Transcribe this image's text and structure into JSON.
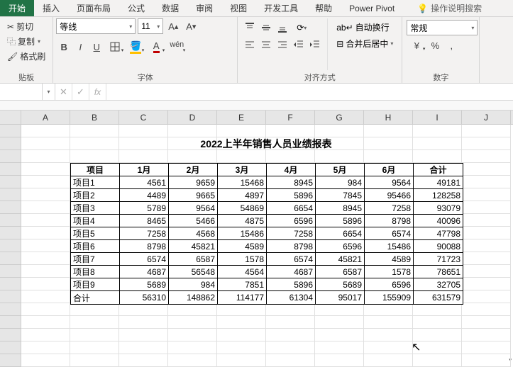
{
  "tabs": {
    "start": "开始",
    "insert": "插入",
    "pageLayout": "页面布局",
    "formula": "公式",
    "data": "数据",
    "review": "审阅",
    "view": "视图",
    "devTools": "开发工具",
    "help": "帮助",
    "powerPivot": "Power Pivot",
    "search": "操作说明搜索"
  },
  "clipboard": {
    "cut": "剪切",
    "copy": "复制",
    "formatPainter": "格式刷",
    "group": "贴板"
  },
  "font": {
    "name": "等线",
    "size": "11",
    "group": "字体"
  },
  "align": {
    "wrap": "自动换行",
    "merge": "合并后居中",
    "group": "对齐方式"
  },
  "number": {
    "format": "常规",
    "group": "数字"
  },
  "formulaBar": {
    "nameBox": "",
    "value": ""
  },
  "cols": [
    "A",
    "B",
    "C",
    "D",
    "E",
    "F",
    "G",
    "H",
    "I",
    "J"
  ],
  "title": "2022上半年销售人员业绩报表",
  "table": {
    "headers": [
      "项目",
      "1月",
      "2月",
      "3月",
      "4月",
      "5月",
      "6月",
      "合计"
    ],
    "rows": [
      [
        "项目1",
        "4561",
        "9659",
        "15468",
        "8945",
        "984",
        "9564",
        "49181"
      ],
      [
        "项目2",
        "4489",
        "9665",
        "4897",
        "5896",
        "7845",
        "95466",
        "128258"
      ],
      [
        "项目3",
        "5789",
        "9564",
        "54869",
        "6654",
        "8945",
        "7258",
        "93079"
      ],
      [
        "项目4",
        "8465",
        "5466",
        "4875",
        "6596",
        "5896",
        "8798",
        "40096"
      ],
      [
        "项目5",
        "7258",
        "4568",
        "15486",
        "7258",
        "6654",
        "6574",
        "47798"
      ],
      [
        "项目6",
        "8798",
        "45821",
        "4589",
        "8798",
        "6596",
        "15486",
        "90088"
      ],
      [
        "项目7",
        "6574",
        "6587",
        "1578",
        "6574",
        "45821",
        "4589",
        "71723"
      ],
      [
        "项目8",
        "4687",
        "56548",
        "4564",
        "4687",
        "6587",
        "1578",
        "78651"
      ],
      [
        "项目9",
        "5689",
        "984",
        "7851",
        "5896",
        "5689",
        "6596",
        "32705"
      ],
      [
        "合计",
        "56310",
        "148862",
        "114177",
        "61304",
        "95017",
        "155909",
        "631579"
      ]
    ]
  },
  "chart_data": {
    "type": "table",
    "title": "2022上半年销售人员业绩报表",
    "columns": [
      "项目",
      "1月",
      "2月",
      "3月",
      "4月",
      "5月",
      "6月",
      "合计"
    ],
    "rows": [
      {
        "项目": "项目1",
        "1月": 4561,
        "2月": 9659,
        "3月": 15468,
        "4月": 8945,
        "5月": 984,
        "6月": 9564,
        "合计": 49181
      },
      {
        "项目": "项目2",
        "1月": 4489,
        "2月": 9665,
        "3月": 4897,
        "4月": 5896,
        "5月": 7845,
        "6月": 95466,
        "合计": 128258
      },
      {
        "项目": "项目3",
        "1月": 5789,
        "2月": 9564,
        "3月": 54869,
        "4月": 6654,
        "5月": 8945,
        "6月": 7258,
        "合计": 93079
      },
      {
        "项目": "项目4",
        "1月": 8465,
        "2月": 5466,
        "3月": 4875,
        "4月": 6596,
        "5月": 5896,
        "6月": 8798,
        "合计": 40096
      },
      {
        "项目": "项目5",
        "1月": 7258,
        "2月": 4568,
        "3月": 15486,
        "4月": 7258,
        "5月": 6654,
        "6月": 6574,
        "合计": 47798
      },
      {
        "项目": "项目6",
        "1月": 8798,
        "2月": 45821,
        "3月": 4589,
        "4月": 8798,
        "5月": 6596,
        "6月": 15486,
        "合计": 90088
      },
      {
        "项目": "项目7",
        "1月": 6574,
        "2月": 6587,
        "3月": 1578,
        "4月": 6574,
        "5月": 45821,
        "6月": 4589,
        "合计": 71723
      },
      {
        "项目": "项目8",
        "1月": 4687,
        "2月": 56548,
        "3月": 4564,
        "4月": 4687,
        "5月": 6587,
        "6月": 1578,
        "合计": 78651
      },
      {
        "项目": "项目9",
        "1月": 5689,
        "2月": 984,
        "3月": 7851,
        "4月": 5896,
        "5月": 5689,
        "6月": 6596,
        "合计": 32705
      },
      {
        "项目": "合计",
        "1月": 56310,
        "2月": 148862,
        "3月": 114177,
        "4月": 61304,
        "5月": 95017,
        "6月": 155909,
        "合计": 631579
      }
    ]
  }
}
